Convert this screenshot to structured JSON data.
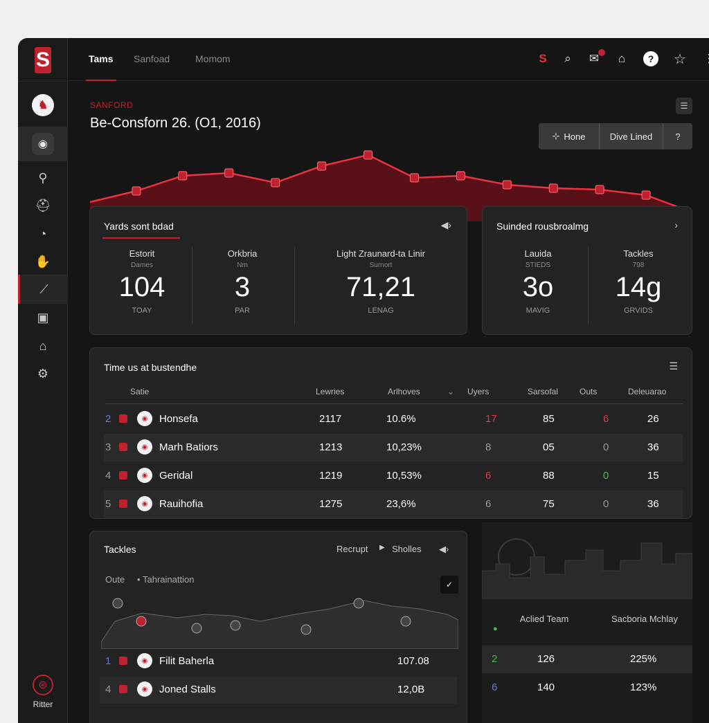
{
  "colors": {
    "accent": "#c0212e",
    "background": "#151516",
    "card": "#232324"
  },
  "sidebar": {
    "logo": "S",
    "items": [
      {
        "icon": "team-logo-icon"
      },
      {
        "icon": "user-profile-icon"
      },
      {
        "icon": "roster-icon"
      },
      {
        "icon": "helmet-icon"
      },
      {
        "icon": "clock-icon"
      },
      {
        "icon": "glove-icon"
      },
      {
        "icon": "analytics-icon"
      },
      {
        "icon": "calendar-icon"
      },
      {
        "icon": "stadium-icon"
      },
      {
        "icon": "gear-icon"
      }
    ],
    "bottom_label": "Ritter"
  },
  "topbar": {
    "tabs": [
      "Tams",
      "Sanfoad",
      "Momom"
    ]
  },
  "header": {
    "school": "SANFORD",
    "title": "Be-Consforn 26. (O1, 2016)"
  },
  "button_group": {
    "home": "Hone",
    "live": "Dive Lined",
    "help": "?"
  },
  "trend_chart": {
    "points": [
      20,
      36,
      58,
      62,
      48,
      72,
      88,
      55,
      58,
      45,
      40,
      38,
      30,
      5
    ]
  },
  "yards_card": {
    "title": "Yards sont bdad",
    "stats": [
      {
        "label": "Estorit",
        "sub": "Dames",
        "value": "104",
        "foot": "TOAY"
      },
      {
        "label": "Orkbria",
        "sub": "Nm",
        "value": "3",
        "foot": "PAR"
      },
      {
        "label": "Light Zraunard-ta Linir",
        "sub": "Surnort",
        "value": "71,21",
        "foot": "LENAG"
      }
    ]
  },
  "side_card": {
    "title": "Suinded rousbroalmg",
    "stats": [
      {
        "label": "Lauida",
        "sub": "STIEDS",
        "value": "3o",
        "foot": "MAVIG"
      },
      {
        "label": "Tackles",
        "sub": "798",
        "value": "14g",
        "foot": "GRVIDS"
      }
    ]
  },
  "table": {
    "title": "Time us at bustendhe",
    "headers": [
      "Satie",
      "Lewries",
      "Arlhoves",
      "Uyers",
      "Sarsofal",
      "Outs",
      "Deleuarao"
    ],
    "rows": [
      {
        "rank": "2",
        "name": "Honsefa",
        "c1": "2117",
        "c2": "10.6%",
        "c3": "17",
        "c4": "85",
        "c5": "6",
        "c6": "26",
        "c3c": "red",
        "c5c": "red",
        "rc": "blue"
      },
      {
        "rank": "3",
        "name": "Marh Batiors",
        "c1": "1213",
        "c2": "10,23%",
        "c3": "8",
        "c4": "05",
        "c5": "0",
        "c6": "36",
        "c3c": "grey",
        "c5c": "grey",
        "rc": "grey"
      },
      {
        "rank": "4",
        "name": "Geridal",
        "c1": "1219",
        "c2": "10,53%",
        "c3": "6",
        "c4": "88",
        "c5": "0",
        "c6": "15",
        "c3c": "red",
        "c5c": "green",
        "rc": "grey"
      },
      {
        "rank": "5",
        "name": "Rauihofia",
        "c1": "1275",
        "c2": "23,6%",
        "c3": "6",
        "c4": "75",
        "c5": "0",
        "c6": "36",
        "c3c": "grey",
        "c5c": "grey",
        "rc": "grey"
      }
    ]
  },
  "tackles_card": {
    "title": "Tackles",
    "filter_1": "Recrupt",
    "filter_2": "Sholles",
    "legend_1": "Oute",
    "legend_2": "Tahrainattion",
    "rows": [
      {
        "rank": "1",
        "name": "Filit Baherla",
        "value": "107.08",
        "rc": "blue"
      },
      {
        "rank": "4",
        "name": "Joned Stalls",
        "value": "12,0B",
        "rc": "grey"
      }
    ]
  },
  "team_card": {
    "col1": "Aclied Team",
    "col2": "Sacboria Mchlay",
    "rows": [
      {
        "rank": "2",
        "a": "126",
        "b": "225%",
        "rc": "green"
      },
      {
        "rank": "6",
        "a": "140",
        "b": "123%",
        "rc": "blue"
      }
    ]
  }
}
